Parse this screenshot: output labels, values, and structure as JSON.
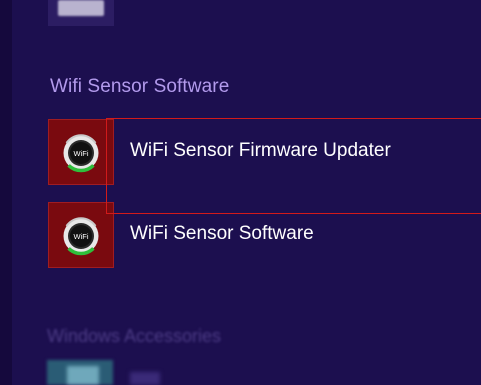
{
  "group": {
    "header": "Wifi Sensor Software"
  },
  "apps": [
    {
      "label": "WiFi Sensor Firmware Updater",
      "icon_text": "WiFi",
      "icon": "wifi-sensor-icon"
    },
    {
      "label": "WiFi Sensor Software",
      "icon_text": "WiFi",
      "icon": "wifi-sensor-icon"
    }
  ],
  "next_group": {
    "header": "Windows Accessories"
  },
  "colors": {
    "background": "#1c0f4f",
    "group_header": "#b29aec",
    "tile": "#7a0a0f",
    "selection": "#d21a1a"
  }
}
